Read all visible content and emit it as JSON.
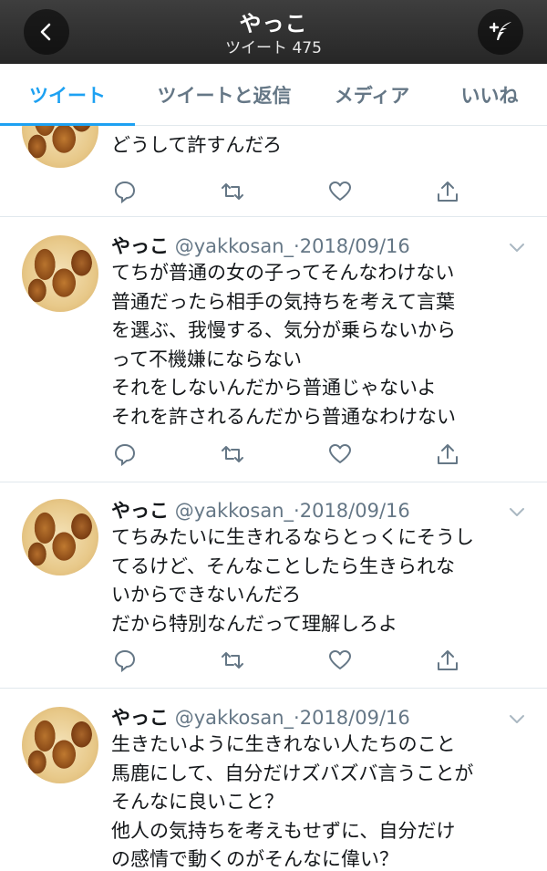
{
  "header": {
    "title": "やっこ",
    "subtitle": "ツイート 475",
    "back_icon": "chevron-left-icon",
    "compose_icon": "compose-feather-icon"
  },
  "tabs": [
    {
      "label": "ツイート",
      "active": true
    },
    {
      "label": "ツイートと返信",
      "active": false
    },
    {
      "label": "メディア",
      "active": false
    },
    {
      "label": "いいね",
      "active": false
    }
  ],
  "colors": {
    "accent": "#1da1f2",
    "secondary_text": "#657786",
    "divider": "#e1e8ed"
  },
  "tweets": [
    {
      "name": "",
      "handle": "",
      "date": "",
      "text": "どうして許すんだろ"
    },
    {
      "name": "やっこ",
      "handle": "@yakkosan_",
      "dot": "·",
      "date": "2018/09/16",
      "text": "てちが普通の女の子ってそんなわけない\n普通だったら相手の気持ちを考えて言葉\nを選ぶ、我慢する、気分が乗らないから\nって不機嫌にならない\nそれをしないんだから普通じゃないよ\nそれを許されるんだから普通なわけない"
    },
    {
      "name": "やっこ",
      "handle": "@yakkosan_",
      "dot": "·",
      "date": "2018/09/16",
      "text": "てちみたいに生きれるならとっくにそうし\nてるけど、そんなことしたら生きられな\nいからできないんだろ\nだから特別なんだって理解しろよ"
    },
    {
      "name": "やっこ",
      "handle": "@yakkosan_",
      "dot": "·",
      "date": "2018/09/16",
      "text": "生きたいように生きれない人たちのこと\n馬鹿にして、自分だけズバズバ言うことが\nそんなに良いこと？\n他人の気持ちを考えもせずに、自分だけ\nの感情で動くのがそんなに偉い？"
    }
  ],
  "action_icons": [
    "reply-icon",
    "retweet-icon",
    "like-heart-icon",
    "share-icon"
  ]
}
